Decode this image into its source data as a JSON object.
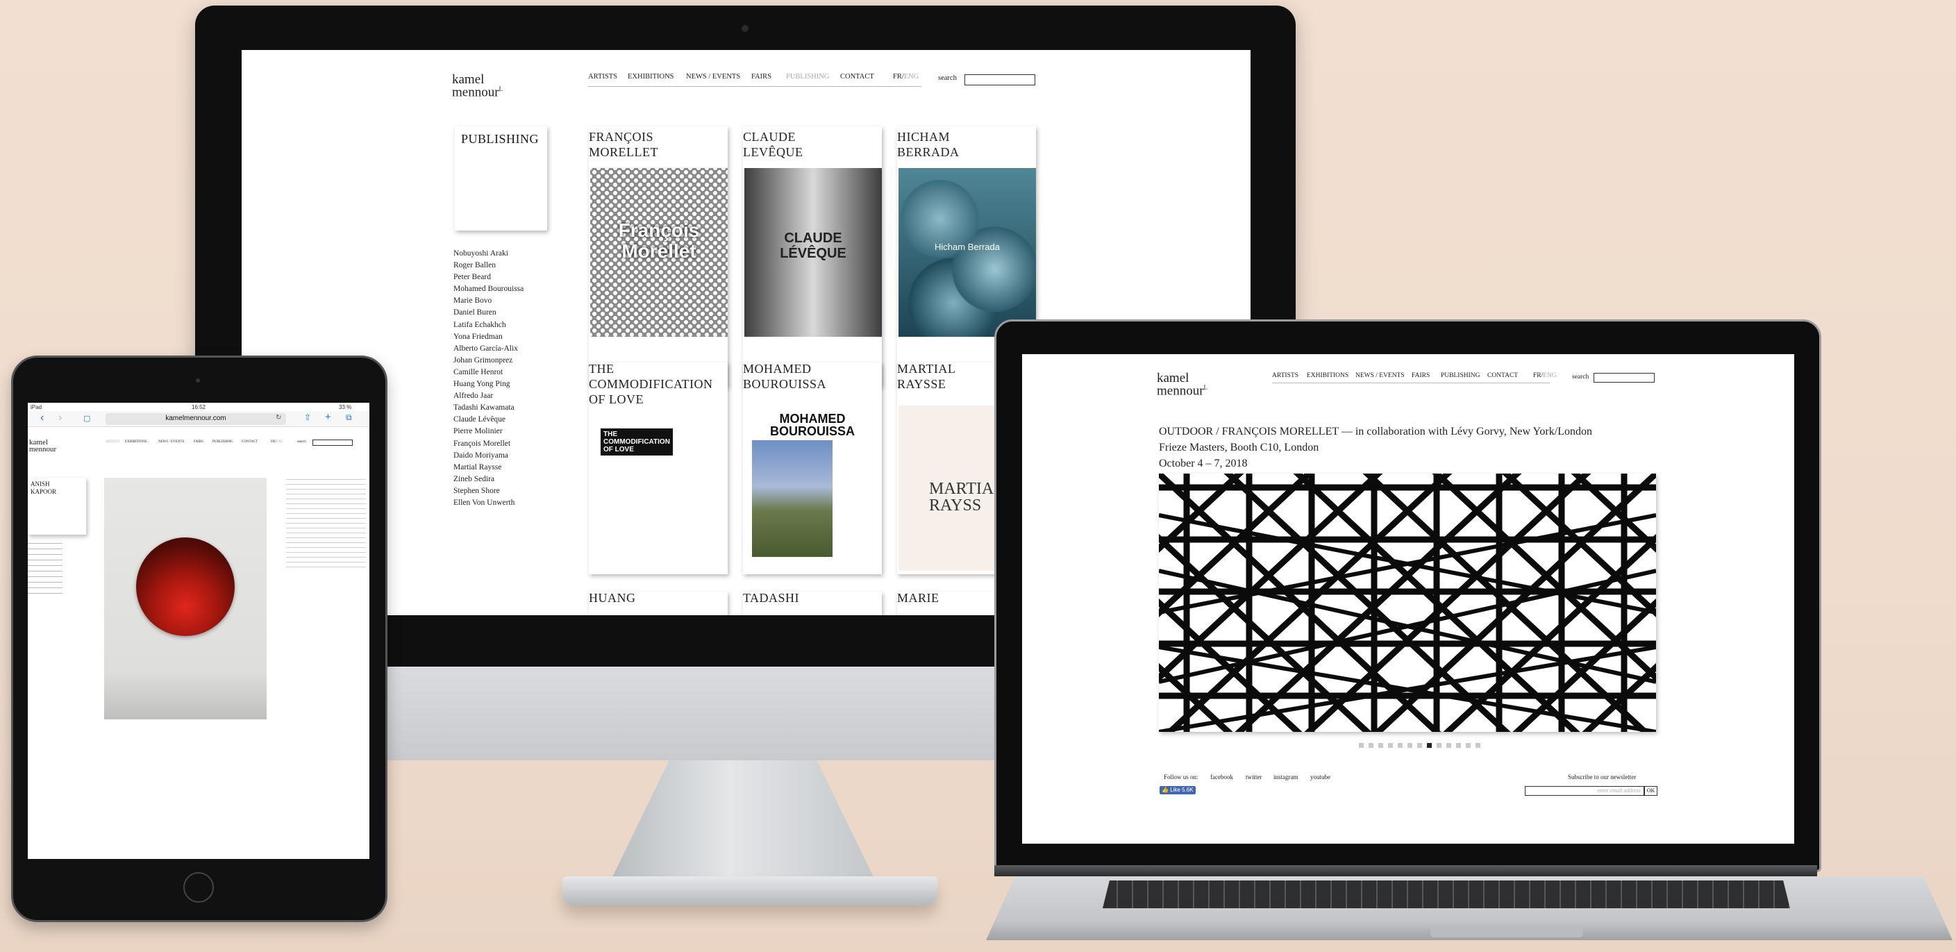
{
  "brand": {
    "line1": "kamel",
    "line2": "mennour",
    "mark": "L"
  },
  "nav": {
    "items": [
      "ARTISTS",
      "EXHIBITIONS",
      "NEWS / EVENTS",
      "FAIRS",
      "PUBLISHING",
      "CONTACT"
    ],
    "lang_fr": "FR",
    "lang_sep": "/",
    "lang_eng": "ENG",
    "search_label": "search"
  },
  "imac": {
    "section_title": "PUBLISHING",
    "artists": [
      "Nobuyoshi Araki",
      "Roger Ballen",
      "Peter Beard",
      "Mohamed Bourouissa",
      "Marie Bovo",
      "Daniel Buren",
      "Latifa Echakhch",
      "Yona Friedman",
      "Alberto García-Alix",
      "Johan Grimonprez",
      "Camille Henrot",
      "Huang Yong Ping",
      "Alfredo Jaar",
      "Tadashi Kawamata",
      "Claude Lévêque",
      "Pierre Molinier",
      "François Morellet",
      "Daido Moriyama",
      "Martial Raysse",
      "Zineb Sedira",
      "Stephen Shore",
      "Ellen Von Unwerth"
    ],
    "cards": [
      {
        "title": "FRANÇOIS\nMORELLET",
        "cover_text": "François\nMorellet"
      },
      {
        "title": "CLAUDE\nLEVÊQUE",
        "cover_text": "CLAUDE\nLÉVÊQUE"
      },
      {
        "title": "HICHAM\nBERRADA",
        "cover_text": "Hicham Berrada"
      },
      {
        "title": "THE COMMODIFICATION\nOF LOVE",
        "cover_text": "THE\nCOMMODIFICATION\nOF LOVE"
      },
      {
        "title": "MOHAMED\nBOUROUISSA",
        "cover_text": "MOHAMED\nBOUROUISSA"
      },
      {
        "title": "MARTIAL\nRAYSSE",
        "cover_text": "MARTIA\nRAYSS"
      },
      {
        "title": "HUANG"
      },
      {
        "title": "TADASHI"
      },
      {
        "title": "MARIE"
      }
    ]
  },
  "ipad": {
    "status_left": "iPad",
    "status_time": "16:52",
    "status_right": "33 %",
    "url": "kamelmennour.com",
    "artist_name": "ANISH\nKAPOOR"
  },
  "macbook": {
    "headline": "OUTDOOR / FRANÇOIS MORELLET — in collaboration with Lévy Gorvy, New York/London",
    "location": "Frieze Masters, Booth C10, London",
    "dates": "October 4 – 7, 2018",
    "follow_label": "Follow us on:",
    "social": [
      "facebook",
      "twitter",
      "instagram",
      "youtube"
    ],
    "like_label": "Like",
    "like_count": "5.6K",
    "newsletter_label": "Subscribe to our newsletter",
    "newsletter_placeholder": "enter email address",
    "ok_label": "OK",
    "slide_count": 13,
    "active_slide": 7
  }
}
